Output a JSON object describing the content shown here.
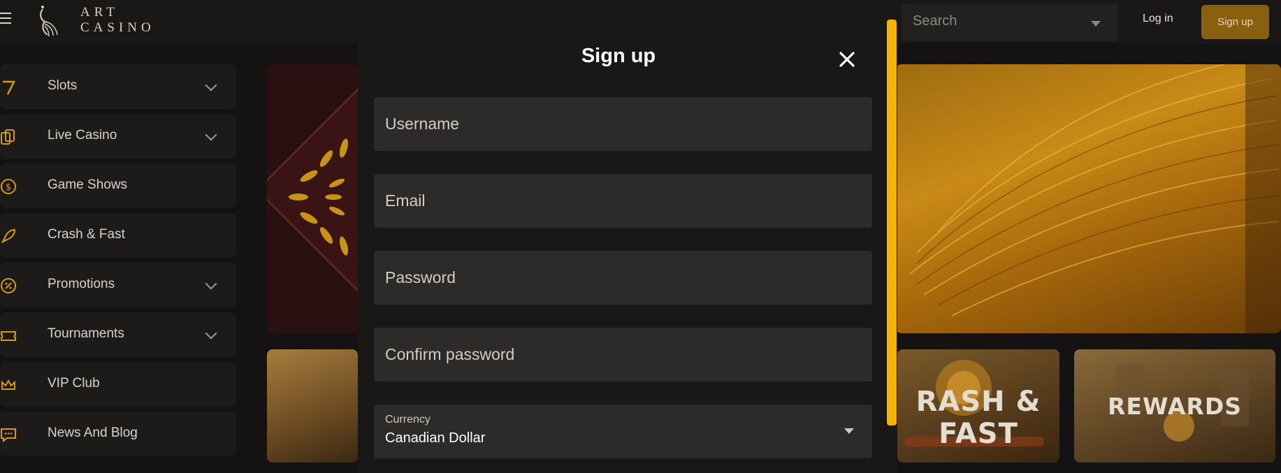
{
  "header": {
    "logo_line1": "ART",
    "logo_line2": "CASINO",
    "search_placeholder": "Search",
    "login_label": "Log in",
    "signup_label": "Sign up"
  },
  "sidebar": {
    "items": [
      {
        "label": "Slots",
        "icon": "slot-seven-icon",
        "expandable": true
      },
      {
        "label": "Live Casino",
        "icon": "cards-icon",
        "expandable": true
      },
      {
        "label": "Game Shows",
        "icon": "coin-icon",
        "expandable": false
      },
      {
        "label": "Crash & Fast",
        "icon": "rocket-icon",
        "expandable": false
      },
      {
        "label": "Promotions",
        "icon": "percent-icon",
        "expandable": true
      },
      {
        "label": "Tournaments",
        "icon": "ticket-icon",
        "expandable": true
      },
      {
        "label": "VIP Club",
        "icon": "crown-icon",
        "expandable": false
      },
      {
        "label": "News And Blog",
        "icon": "chat-icon",
        "expandable": false
      }
    ]
  },
  "main": {
    "cards": [
      {
        "label": "RASH & FAST"
      },
      {
        "label": "REWARDS"
      }
    ]
  },
  "modal": {
    "title": "Sign up",
    "fields": {
      "username_placeholder": "Username",
      "email_placeholder": "Email",
      "password_placeholder": "Password",
      "confirm_placeholder": "Confirm password"
    },
    "currency": {
      "label": "Currency",
      "value": "Canadian Dollar"
    }
  },
  "colors": {
    "accent": "#f5b207",
    "signup_button": "#8a5f0f",
    "icon_gold": "#d89a14",
    "background": "#141212"
  }
}
